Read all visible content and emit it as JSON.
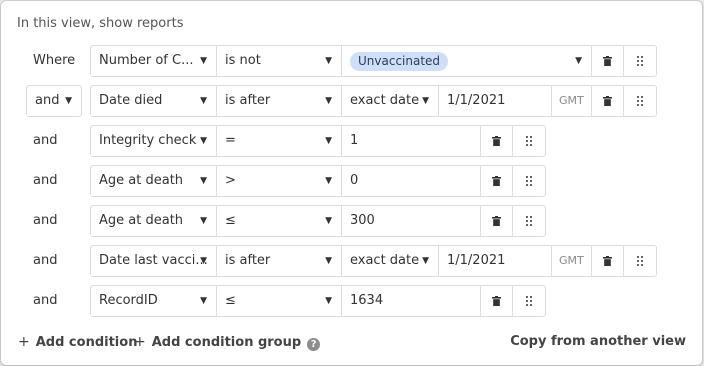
{
  "header": {
    "title": "In this view, show reports"
  },
  "rows": [
    {
      "conjunction": "Where",
      "field": "Number of C...",
      "operator": "is not",
      "value": "Unvaccinated"
    },
    {
      "conjunction": "and",
      "field": "Date died",
      "operator": "is after",
      "mode": "exact date",
      "value": "1/1/2021",
      "tz": "GMT"
    },
    {
      "conjunction": "and",
      "field": "Integrity check",
      "operator": "=",
      "value": "1"
    },
    {
      "conjunction": "and",
      "field": "Age at death",
      "operator": ">",
      "value": "0"
    },
    {
      "conjunction": "and",
      "field": "Age at death",
      "operator": "≤",
      "value": "300"
    },
    {
      "conjunction": "and",
      "field": "Date last vacci...",
      "operator": "is after",
      "mode": "exact date",
      "value": "1/1/2021",
      "tz": "GMT"
    },
    {
      "conjunction": "and",
      "field": "RecordID",
      "operator": "≤",
      "value": "1634"
    }
  ],
  "footer": {
    "plus": "+",
    "add_condition": "Add condition",
    "add_condition_group": "Add condition group",
    "help": "?",
    "copy_from_view": "Copy from another view"
  },
  "glyphs": {
    "dropdown_arrow": "▼"
  },
  "colors": {
    "pill_bg": "#cfdff7",
    "border": "#dcdcdc",
    "muted_text": "#8a8a8a"
  }
}
